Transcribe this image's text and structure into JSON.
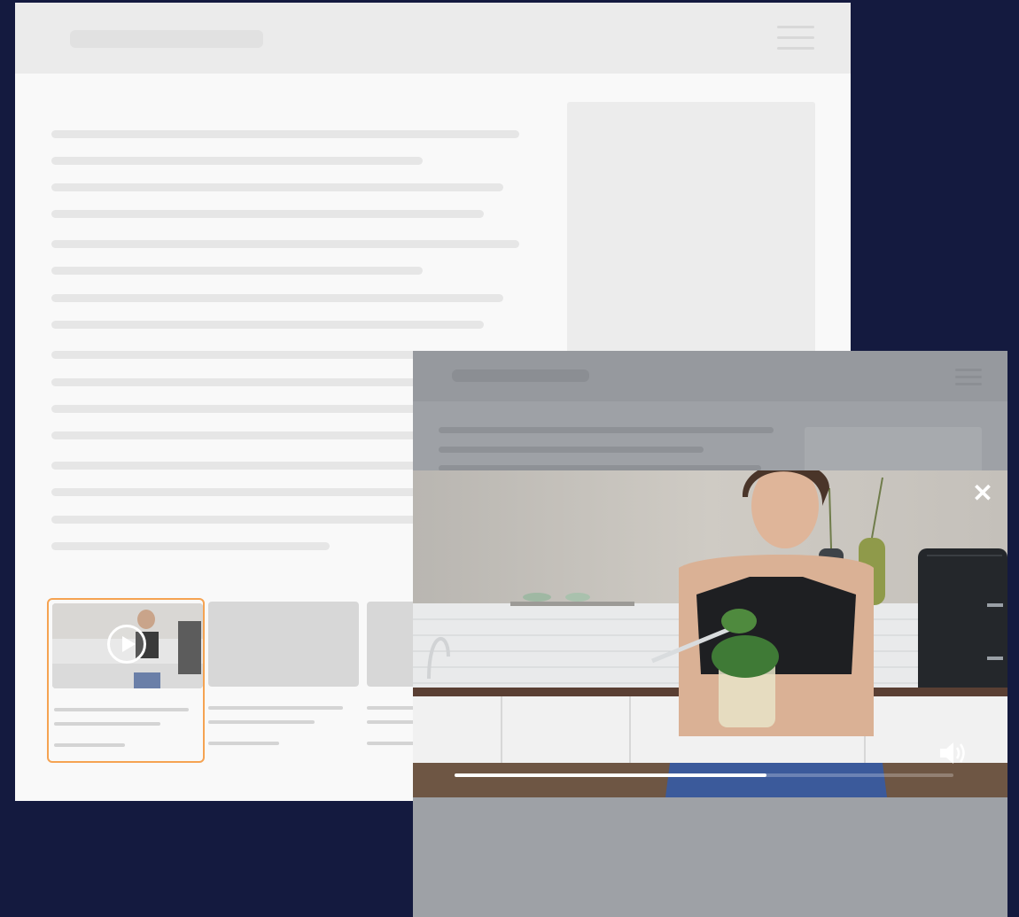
{
  "desktop_page": {
    "header": {
      "title_placeholder": "",
      "menu_icon": "hamburger-icon"
    },
    "thumbnails": [
      {
        "selected": true,
        "has_video": true,
        "play_icon": "play-icon"
      },
      {
        "selected": false,
        "has_video": false
      },
      {
        "selected": false,
        "has_video": false
      }
    ],
    "accent_color": "#f5a352"
  },
  "mobile_page": {
    "header": {
      "menu_icon": "hamburger-icon"
    },
    "video_player": {
      "close_icon": "close-icon",
      "close_label": "✕",
      "volume_icon": "volume-icon",
      "progress": 0.625
    }
  },
  "colors": {
    "background": "#141a3f",
    "page": "#f9f9f9",
    "overlay": "#9ea1a6"
  }
}
